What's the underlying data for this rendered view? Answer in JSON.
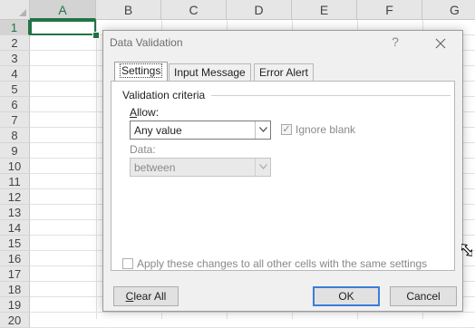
{
  "sheet": {
    "columns": [
      "A",
      "B",
      "C",
      "D",
      "E",
      "F",
      "G"
    ],
    "rows": [
      "1",
      "2",
      "3",
      "4",
      "5",
      "6",
      "7",
      "8",
      "9",
      "10",
      "11",
      "12",
      "13",
      "14",
      "15",
      "16",
      "17",
      "18",
      "19",
      "20"
    ],
    "active_column": "A",
    "active_row": "1"
  },
  "dialog": {
    "title": "Data Validation",
    "help": "?",
    "close": "✕",
    "tabs": [
      {
        "label": "Settings",
        "active": true
      },
      {
        "label": "Input Message",
        "active": false
      },
      {
        "label": "Error Alert",
        "active": false
      }
    ],
    "group_label": "Validation criteria",
    "allow_label": "Allow:",
    "allow_value": "Any value",
    "ignore_blank_label": "Ignore blank",
    "ignore_blank_checked": true,
    "data_label": "Data:",
    "data_value": "between",
    "apply_label": "Apply these changes to all other cells with the same settings",
    "buttons": {
      "clear_all": "Clear All",
      "ok": "OK",
      "cancel": "Cancel"
    }
  },
  "colors": {
    "excel_green": "#217346",
    "focus_blue": "#3b7dd8"
  }
}
